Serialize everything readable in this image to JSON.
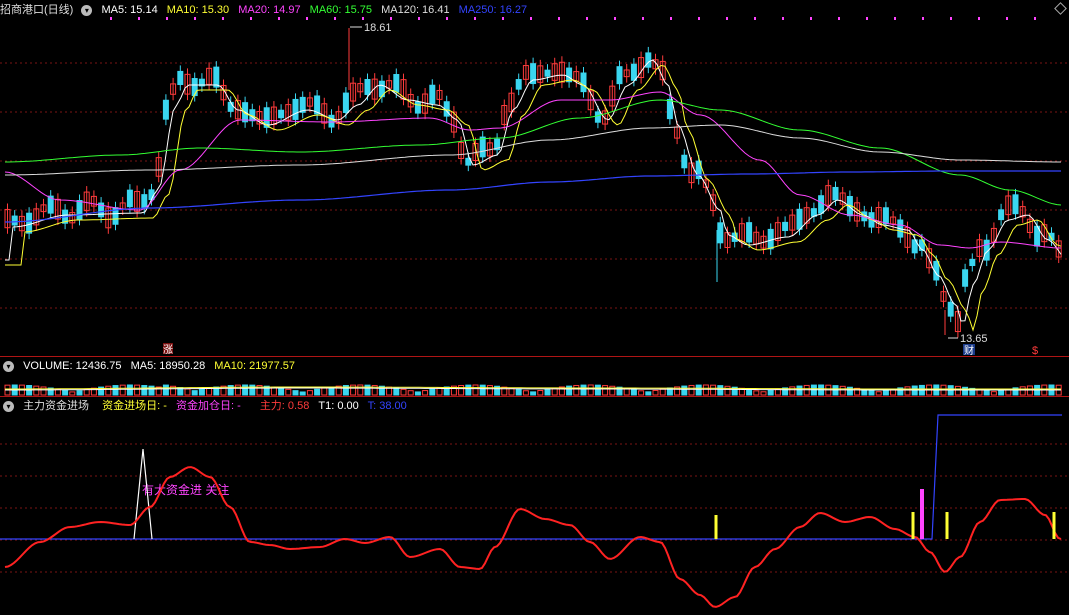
{
  "colors": {
    "bg": "#000000",
    "up": "#ff3b3b",
    "down": "#3ad6f0",
    "ma5": "#ffffff",
    "ma10": "#ffff33",
    "ma20": "#ff44ff",
    "ma60": "#33ff33",
    "ma120": "#dddddd",
    "ma250": "#3344ff",
    "grid": "#7a1414"
  },
  "price_panel": {
    "stock_title": "招商港口(日线)",
    "ma_items": [
      {
        "label": "MA5: 15.14",
        "color": "#ffffff"
      },
      {
        "label": "MA10: 15.30",
        "color": "#ffff33"
      },
      {
        "label": "MA20: 14.97",
        "color": "#ff44ff"
      },
      {
        "label": "MA60: 15.75",
        "color": "#33ff33"
      },
      {
        "label": "MA120: 16.41",
        "color": "#dddddd"
      },
      {
        "label": "MA250: 16.27",
        "color": "#3344ff"
      }
    ],
    "high_label": "18.61",
    "low_label": "13.65",
    "marker_zhang": "涨",
    "marker_cai": "财",
    "marker_dollar": "$"
  },
  "volume_panel": {
    "items": [
      {
        "label": "VOLUME: 12436.75",
        "color": "#ffffff"
      },
      {
        "label": "MA5: 18950.28",
        "color": "#ffffff"
      },
      {
        "label": "MA10: 21977.57",
        "color": "#ffff33"
      }
    ]
  },
  "indicator_panel": {
    "name": "主力资金进场",
    "items": [
      {
        "label": "资金进场日: -",
        "color": "#ffff33"
      },
      {
        "label": "资金加仓日: -",
        "color": "#ff44ff"
      },
      {
        "label": "主力: 0.58",
        "color": "#ff3b3b"
      },
      {
        "label": "T1: 0.00",
        "color": "#ffffff"
      },
      {
        "label": "T: 38.00",
        "color": "#3344ff"
      }
    ],
    "annotation": "有大资金进 关注"
  }
}
